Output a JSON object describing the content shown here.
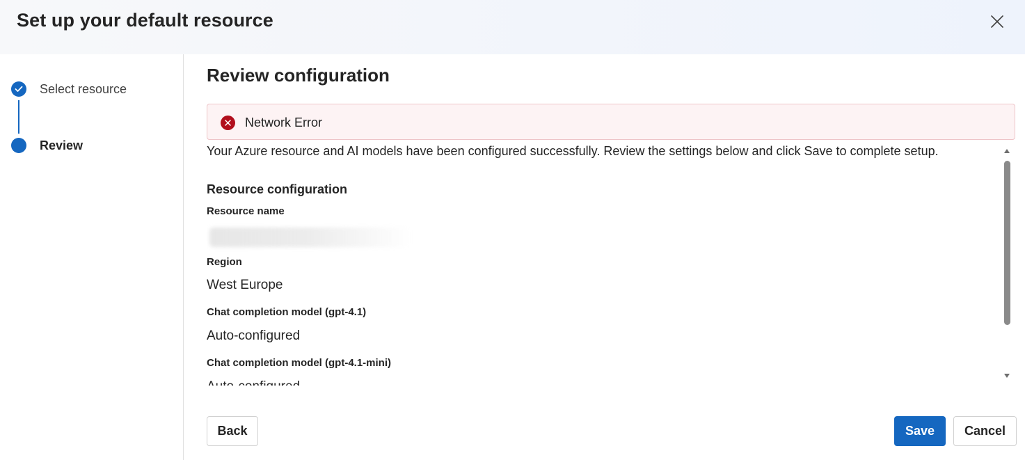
{
  "dialog": {
    "title": "Set up your default resource"
  },
  "steps": [
    {
      "label": "Select resource",
      "state": "completed"
    },
    {
      "label": "Review",
      "state": "current"
    }
  ],
  "main": {
    "section_title": "Review configuration",
    "error": {
      "message": "Network Error"
    },
    "intro": "Your Azure resource and AI models have been configured successfully. Review the settings below and click Save to complete setup.",
    "config_heading": "Resource configuration",
    "fields": [
      {
        "label": "Resource name",
        "value": ""
      },
      {
        "label": "Region",
        "value": "West Europe"
      },
      {
        "label": "Chat completion model (gpt-4.1)",
        "value": "Auto-configured"
      },
      {
        "label": "Chat completion model (gpt-4.1-mini)",
        "value": "Auto-configured"
      }
    ]
  },
  "footer": {
    "back_label": "Back",
    "save_label": "Save",
    "cancel_label": "Cancel"
  },
  "icons": {
    "close": "close-icon",
    "check": "checkmark-icon",
    "error": "error-circle-icon"
  },
  "colors": {
    "accent": "#1567c0",
    "error": "#b10e1c",
    "error_background": "#fdf3f4"
  }
}
